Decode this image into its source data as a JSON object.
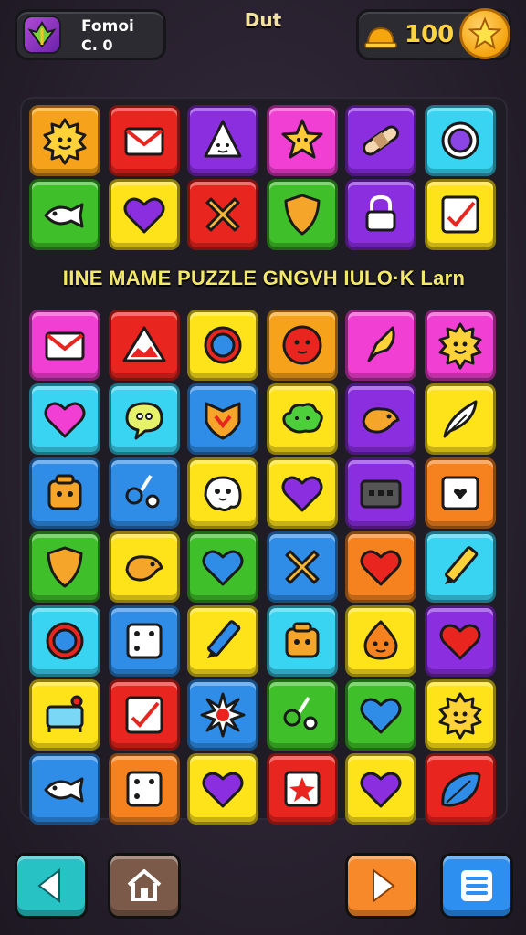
{
  "header": {
    "profile_name": "Fomoi",
    "profile_score": "C. 0",
    "level_title": "Dut",
    "coins": "100"
  },
  "banner": "IINE MAME PUZZLE GNGVH IULO·K Larn",
  "colors": {
    "orange": "#f7a21b",
    "red": "#e8251f",
    "purple": "#8b2ee0",
    "magenta": "#f23fd3",
    "cyan": "#39d4f2",
    "green": "#3fbf2a",
    "yellow": "#ffe31a",
    "blue": "#2f8de8",
    "deep_orange": "#f5821f"
  },
  "board": {
    "columns": 6,
    "rows": [
      [
        {
          "color": "orange",
          "icon": "sun-face-icon"
        },
        {
          "color": "red",
          "icon": "envelope-icon"
        },
        {
          "color": "purple",
          "icon": "triangle-face-icon"
        },
        {
          "color": "magenta",
          "icon": "star-face-icon"
        },
        {
          "color": "purple",
          "icon": "bandage-icon"
        },
        {
          "color": "cyan",
          "icon": "gear-icon"
        }
      ],
      [
        {
          "color": "green",
          "icon": "fish-icon"
        },
        {
          "color": "yellow",
          "icon": "heart-icon"
        },
        {
          "color": "red",
          "icon": "cross-icon"
        },
        {
          "color": "green",
          "icon": "shield-icon"
        },
        {
          "color": "purple",
          "icon": "lock-icon"
        },
        {
          "color": "yellow",
          "icon": "checkbox-icon"
        }
      ],
      [
        {
          "color": "magenta",
          "icon": "envelope-icon"
        },
        {
          "color": "red",
          "icon": "mountain-icon"
        },
        {
          "color": "yellow",
          "icon": "ring-icon"
        },
        {
          "color": "orange",
          "icon": "ball-face-icon"
        },
        {
          "color": "magenta",
          "icon": "horn-icon"
        },
        {
          "color": "magenta",
          "icon": "sun-face-icon"
        }
      ],
      [
        {
          "color": "cyan",
          "icon": "heart-icon"
        },
        {
          "color": "cyan",
          "icon": "speech-bubble-icon"
        },
        {
          "color": "blue",
          "icon": "badge-icon"
        },
        {
          "color": "yellow",
          "icon": "cloud-face-icon"
        },
        {
          "color": "purple",
          "icon": "bird-icon"
        },
        {
          "color": "yellow",
          "icon": "feather-icon"
        }
      ],
      [
        {
          "color": "blue",
          "icon": "robot-icon"
        },
        {
          "color": "blue",
          "icon": "scissors-icon"
        },
        {
          "color": "yellow",
          "icon": "ghost-face-icon"
        },
        {
          "color": "yellow",
          "icon": "heart-icon"
        },
        {
          "color": "purple",
          "icon": "camera-icon"
        },
        {
          "color": "deep_orange",
          "icon": "photo-icon"
        }
      ],
      [
        {
          "color": "green",
          "icon": "shield-icon"
        },
        {
          "color": "yellow",
          "icon": "bird-icon"
        },
        {
          "color": "green",
          "icon": "heart-icon"
        },
        {
          "color": "blue",
          "icon": "cross-icon"
        },
        {
          "color": "deep_orange",
          "icon": "heart-icon"
        },
        {
          "color": "cyan",
          "icon": "pencil-icon"
        }
      ],
      [
        {
          "color": "cyan",
          "icon": "ring-icon"
        },
        {
          "color": "blue",
          "icon": "dice-icon"
        },
        {
          "color": "yellow",
          "icon": "pencil-icon"
        },
        {
          "color": "cyan",
          "icon": "robot-icon"
        },
        {
          "color": "yellow",
          "icon": "drop-face-icon"
        },
        {
          "color": "purple",
          "icon": "heart-icon"
        }
      ],
      [
        {
          "color": "yellow",
          "icon": "bed-icon"
        },
        {
          "color": "red",
          "icon": "checkbox-icon"
        },
        {
          "color": "blue",
          "icon": "burst-icon"
        },
        {
          "color": "green",
          "icon": "scissors-icon"
        },
        {
          "color": "green",
          "icon": "heart-icon"
        },
        {
          "color": "yellow",
          "icon": "sun-face-icon"
        }
      ],
      [
        {
          "color": "blue",
          "icon": "fish-icon"
        },
        {
          "color": "deep_orange",
          "icon": "dice-icon"
        },
        {
          "color": "yellow",
          "icon": "heart-icon"
        },
        {
          "color": "red",
          "icon": "star-card-icon"
        },
        {
          "color": "yellow",
          "icon": "heart-icon"
        },
        {
          "color": "red",
          "icon": "leaf-icon"
        }
      ]
    ]
  },
  "controls": [
    {
      "name": "back-button",
      "icon": "arrow-left-icon"
    },
    {
      "name": "home-button",
      "icon": "home-icon"
    },
    {
      "name": "play-button",
      "icon": "play-icon"
    },
    {
      "name": "menu-button",
      "icon": "menu-icon"
    }
  ]
}
